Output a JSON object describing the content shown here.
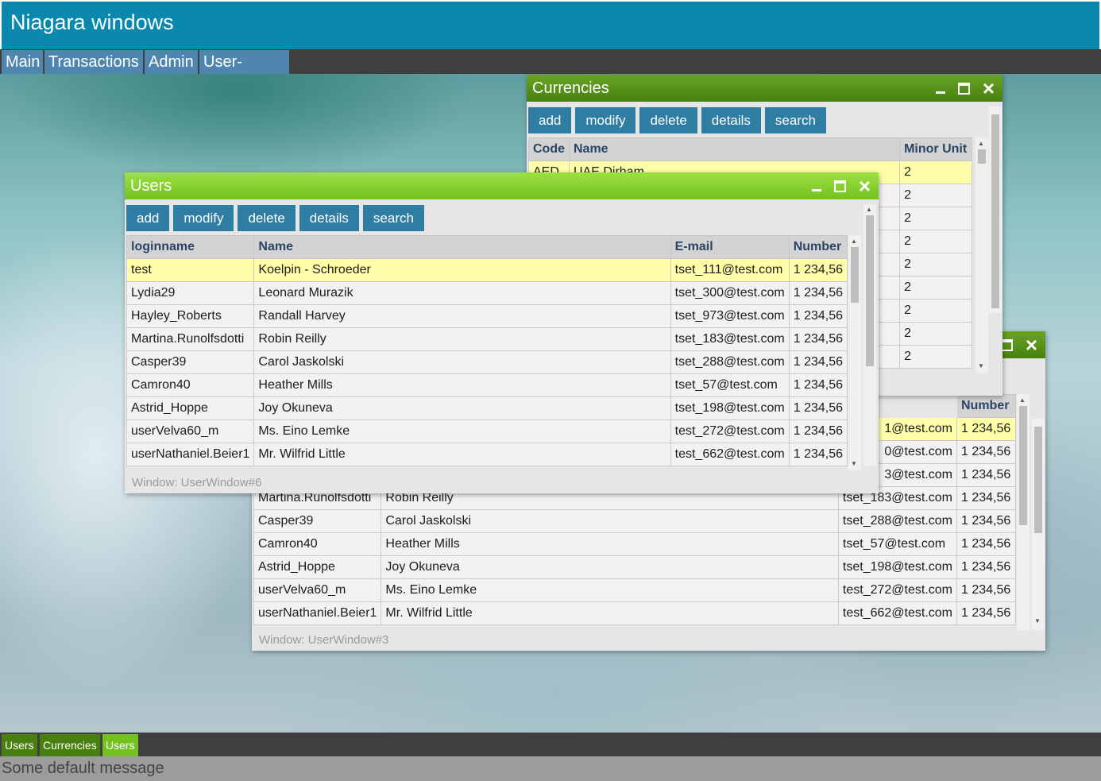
{
  "app": {
    "title": "Niagara windows"
  },
  "menu": [
    "Main",
    "Transactions",
    "Admin",
    "User-profile"
  ],
  "toolbar": [
    "add",
    "modify",
    "delete",
    "details",
    "search"
  ],
  "currencies_window": {
    "title": "Currencies",
    "columns": [
      "Code",
      "Name",
      "Minor Unit"
    ],
    "first_row": {
      "code": "AED",
      "name": "UAE Dirham",
      "minor_unit": "2"
    },
    "minor_units": [
      "2",
      "2",
      "2",
      "2",
      "2",
      "2",
      "2",
      "2"
    ]
  },
  "users_columns": [
    "loginname",
    "Name",
    "E-mail",
    "Number"
  ],
  "users_rows": [
    {
      "login": "test",
      "name": "Koelpin - Schroeder",
      "email": "tset_111@test.com",
      "number": "1 234,56"
    },
    {
      "login": "Lydia29",
      "name": "Leonard Murazik",
      "email": "tset_300@test.com",
      "number": "1 234,56"
    },
    {
      "login": "Hayley_Roberts",
      "name": "Randall Harvey",
      "email": "tset_973@test.com",
      "number": "1 234,56"
    },
    {
      "login": "Martina.Runolfsdotti",
      "name": "Robin Reilly",
      "email": "tset_183@test.com",
      "number": "1 234,56"
    },
    {
      "login": "Casper39",
      "name": "Carol Jaskolski",
      "email": "tset_288@test.com",
      "number": "1 234,56"
    },
    {
      "login": "Camron40",
      "name": "Heather Mills",
      "email": "tset_57@test.com",
      "number": "1 234,56"
    },
    {
      "login": "Astrid_Hoppe",
      "name": "Joy Okuneva",
      "email": "tset_198@test.com",
      "number": "1 234,56"
    },
    {
      "login": "userVelva60_m",
      "name": "Ms. Eino Lemke",
      "email": "test_272@test.com",
      "number": "1 234,56"
    },
    {
      "login": "userNathaniel.Beier1",
      "name": "Mr. Wilfrid Little",
      "email": "test_662@test.com",
      "number": "1 234,56"
    }
  ],
  "users_window_front": {
    "title": "Users",
    "footer": "Window: UserWindow#6"
  },
  "users_window_back": {
    "footer": "Window: UserWindow#3",
    "visible_email_fragments": [
      "1@test.com",
      "0@test.com",
      "3@test.com"
    ]
  },
  "taskbar": [
    "Users",
    "Currencies",
    "Users"
  ],
  "status": "Some default message",
  "colors": {
    "header": "#0a88ad",
    "menu_item": "#4f86b0",
    "button": "#2f7da3",
    "title_active": "#74c21f",
    "title_inactive": "#47800f",
    "selected_row": "#ffffaa"
  }
}
